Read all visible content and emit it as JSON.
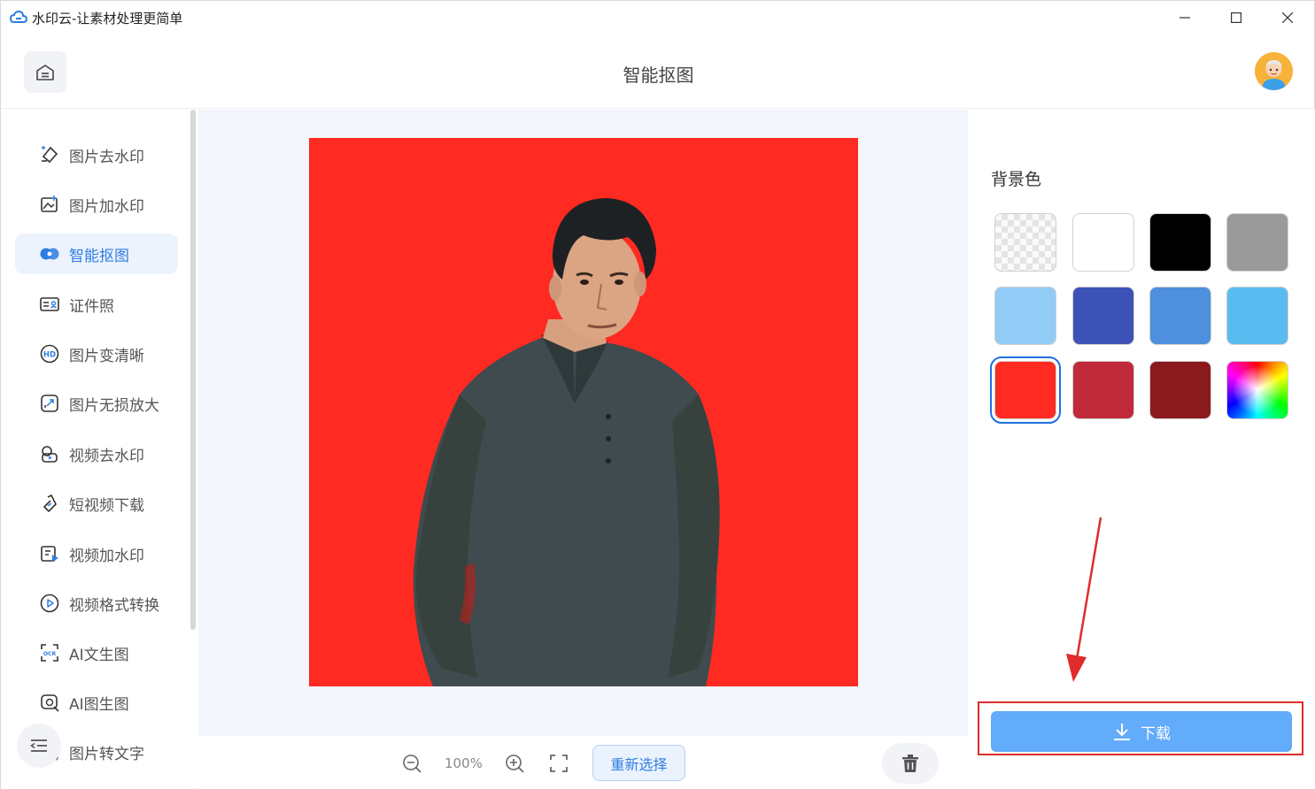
{
  "window": {
    "title": "水印云-让素材处理更简单"
  },
  "header": {
    "title": "智能抠图"
  },
  "sidebar": {
    "items": [
      {
        "label": "图片去水印",
        "icon": "eraser-icon",
        "active": false
      },
      {
        "label": "图片加水印",
        "icon": "image-add-icon",
        "active": false
      },
      {
        "label": "智能抠图",
        "icon": "cutout-icon",
        "active": true
      },
      {
        "label": "证件照",
        "icon": "id-card-icon",
        "active": false
      },
      {
        "label": "图片变清晰",
        "icon": "hd-icon",
        "active": false
      },
      {
        "label": "图片无损放大",
        "icon": "enlarge-icon",
        "active": false
      },
      {
        "label": "视频去水印",
        "icon": "video-eraser-icon",
        "active": false
      },
      {
        "label": "短视频下载",
        "icon": "link-icon",
        "active": false
      },
      {
        "label": "视频加水印",
        "icon": "video-add-icon",
        "active": false
      },
      {
        "label": "视频格式转换",
        "icon": "play-circle-icon",
        "active": false
      },
      {
        "label": "AI文生图",
        "icon": "ocr-icon",
        "active": false
      },
      {
        "label": "AI图生图",
        "icon": "ai-image-icon",
        "active": false
      },
      {
        "label": "图片转文字",
        "icon": "text-icon",
        "active": false
      }
    ]
  },
  "toolbar": {
    "zoom": "100%",
    "reselect_label": "重新选择"
  },
  "panel": {
    "bg_label": "背景色",
    "swatches": [
      {
        "name": "transparent",
        "color": "transparent",
        "selected": false
      },
      {
        "name": "white",
        "color": "#ffffff",
        "selected": false
      },
      {
        "name": "black",
        "color": "#000000",
        "selected": false
      },
      {
        "name": "gray",
        "color": "#9a9a9a",
        "selected": false
      },
      {
        "name": "light-blue",
        "color": "#92cbf6",
        "selected": false
      },
      {
        "name": "royal-blue",
        "color": "#3d52b6",
        "selected": false
      },
      {
        "name": "blue",
        "color": "#4e90dd",
        "selected": false
      },
      {
        "name": "sky-blue",
        "color": "#5abbf0",
        "selected": false
      },
      {
        "name": "red",
        "color": "#ff2a22",
        "selected": true
      },
      {
        "name": "crimson",
        "color": "#c0293a",
        "selected": false
      },
      {
        "name": "dark-red",
        "color": "#8b1a1e",
        "selected": false
      },
      {
        "name": "custom",
        "color": "rainbow",
        "selected": false
      }
    ],
    "download_label": "下载"
  },
  "colors": {
    "accent": "#2f7de1",
    "photo_background": "#ff2a22",
    "download": "#63abfb",
    "highlight": "#e02c2c"
  }
}
